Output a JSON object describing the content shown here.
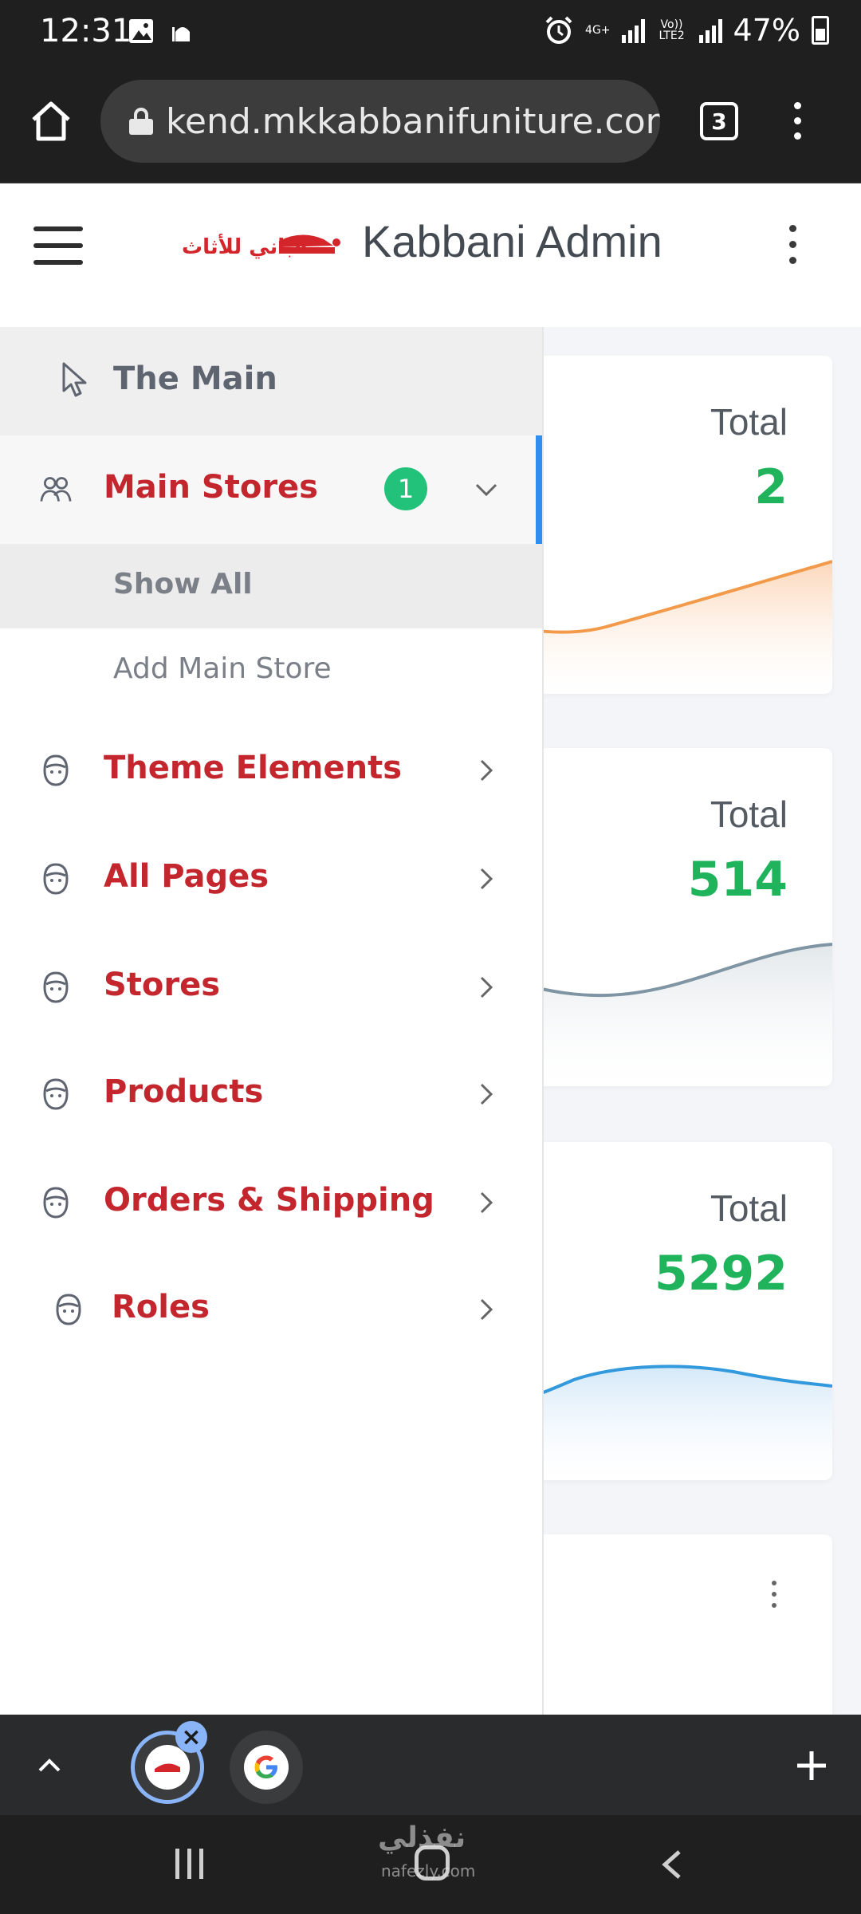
{
  "status_bar": {
    "time": "12:31",
    "network_label": "4G+",
    "volte_label": "Vo)) LTE2",
    "battery": "47%"
  },
  "browser": {
    "url": "kend.mkkabbanifuniture.com",
    "tab_count": "3"
  },
  "header": {
    "logo_text": "قباني للأثاث",
    "title": "Kabbani Admin"
  },
  "sidebar": {
    "head": "The Main",
    "items": [
      {
        "label": "Main Stores",
        "badge": "1",
        "expanded": true,
        "icon": "users-icon"
      },
      {
        "label": "Theme Elements",
        "icon": "face-icon"
      },
      {
        "label": "All Pages",
        "icon": "face-icon"
      },
      {
        "label": "Stores",
        "icon": "face-icon"
      },
      {
        "label": "Products",
        "icon": "face-icon"
      },
      {
        "label": "Orders & Shipping",
        "icon": "face-icon"
      },
      {
        "label": "Roles",
        "icon": "face-icon"
      }
    ],
    "subitems": [
      {
        "label": "Show All",
        "selected": true
      },
      {
        "label": "Add Main Store",
        "selected": false
      }
    ]
  },
  "cards": [
    {
      "label": "Total",
      "value": "2",
      "color": "#f29a4a"
    },
    {
      "label": "Total",
      "value": "514",
      "color": "#7f95a3"
    },
    {
      "label": "Total",
      "value": "5292",
      "color": "#3399dd"
    }
  ],
  "watermark": {
    "arabic": "نفذلي",
    "latin": "nafezly.com"
  },
  "colors": {
    "accent_red": "#c4262e",
    "active_bar": "#2f8eef",
    "badge_green": "#23c27a",
    "value_green": "#1fb35b"
  }
}
